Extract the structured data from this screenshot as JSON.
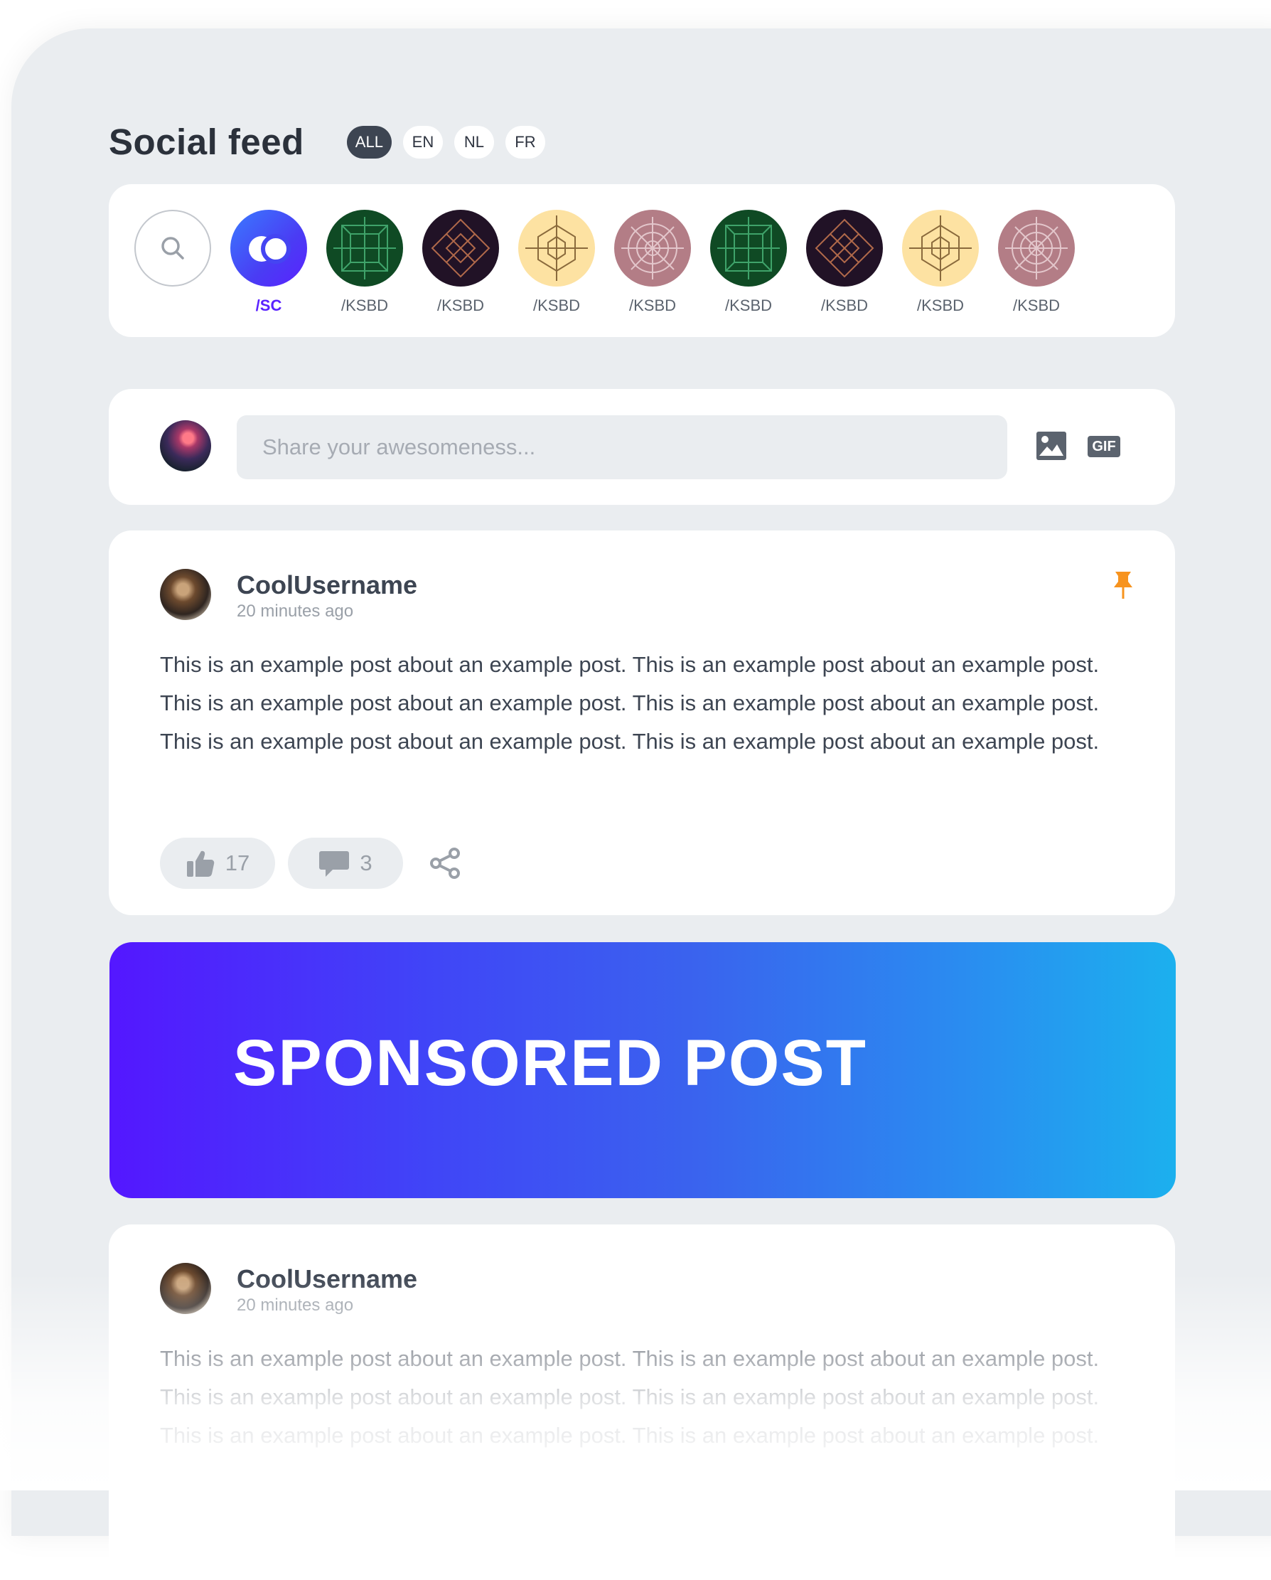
{
  "header": {
    "title": "Social feed",
    "languages": [
      "ALL",
      "EN",
      "NL",
      "FR"
    ],
    "active_language": "ALL"
  },
  "communities": {
    "items": [
      {
        "label": "/SC",
        "style": "sc",
        "active": true
      },
      {
        "label": "/KSBD",
        "style": "green"
      },
      {
        "label": "/KSBD",
        "style": "dark"
      },
      {
        "label": "/KSBD",
        "style": "yellow"
      },
      {
        "label": "/KSBD",
        "style": "pink"
      },
      {
        "label": "/KSBD",
        "style": "green"
      },
      {
        "label": "/KSBD",
        "style": "dark"
      },
      {
        "label": "/KSBD",
        "style": "yellow"
      },
      {
        "label": "/KSBD",
        "style": "pink"
      }
    ]
  },
  "composer": {
    "placeholder": "Share your awesomeness...",
    "gif_label": "GIF"
  },
  "posts": [
    {
      "username": "CoolUsername",
      "time": "20 minutes ago",
      "text": "This is an example post about an example post. This is an example post about an example post. This is an example post about an example post. This is an example post about an example post. This is an example post about an example post. This is an example post about an example post.",
      "likes": "17",
      "comments": "3",
      "pinned": true
    },
    {
      "username": "CoolUsername",
      "time": "20 minutes ago",
      "text": "This is an example post about an example post. This is an example post about an example post. This is an example post about an example post. This is an example post about an example post. This is an example post about an example post. This is an example post about an example post."
    }
  ],
  "sponsored": {
    "label": "SPONSORED POST"
  },
  "colors": {
    "accent": "#5a22ff",
    "pin": "#f7931e",
    "background": "#eaedf0",
    "green": "#0f4a24",
    "dark": "#211226",
    "yellow": "#fde2a2",
    "pink": "#b37d86"
  }
}
